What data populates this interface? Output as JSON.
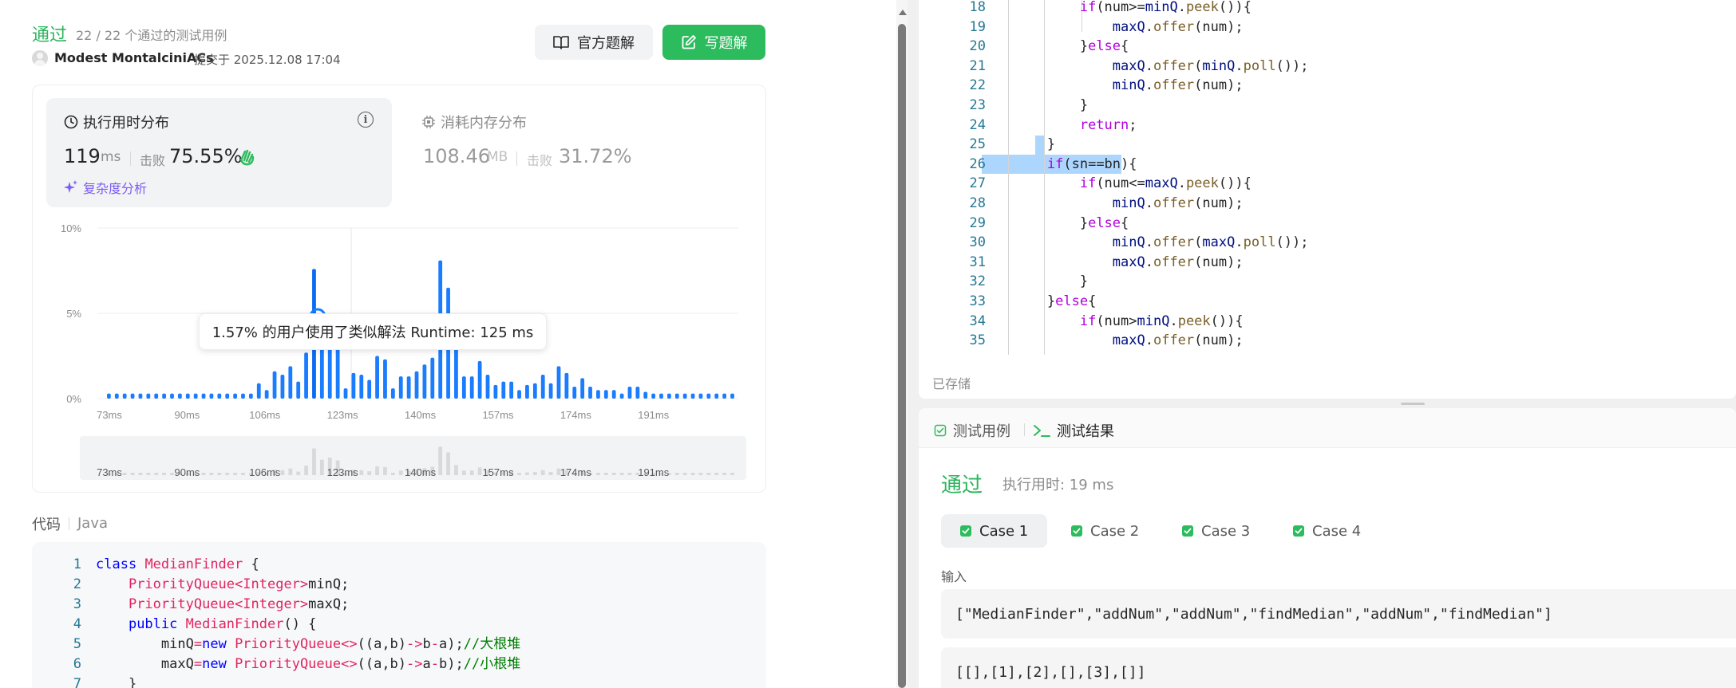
{
  "submission": {
    "status": "通过",
    "passed_cases": "22 / 22 个通过的测试用例",
    "author": "Modest MontalciniACs",
    "submitted_at": "提交于 2025.12.08 17:04",
    "btn_official": "官方题解",
    "btn_write": "写题解"
  },
  "runtime": {
    "title": "执行用时分布",
    "value": "119",
    "unit": "ms",
    "beat_label": "击败",
    "beat_pct": "75.55%",
    "complexity_link": "复杂度分析"
  },
  "memory": {
    "title": "消耗内存分布",
    "value": "108.46",
    "unit": "MB",
    "beat_label": "击败",
    "beat_pct": "31.72%"
  },
  "tooltip": "1.57% 的用户使用了类似解法 Runtime: 125 ms",
  "colors": {
    "accent": "#2cbb5d",
    "bar": "#1a7cff",
    "purple": "#7c5cf5"
  },
  "chart_data": {
    "type": "bar",
    "xlabel": "",
    "ylabel": "",
    "y_ticks": [
      "0%",
      "5%",
      "10%"
    ],
    "x_ticks": [
      "73ms",
      "90ms",
      "106ms",
      "123ms",
      "140ms",
      "157ms",
      "174ms",
      "191ms"
    ],
    "ylim": [
      0,
      10
    ],
    "grid": true,
    "values": [
      0.3,
      0.3,
      0.3,
      0.3,
      0.3,
      0.3,
      0.3,
      0.3,
      0.3,
      0.3,
      0.3,
      0.3,
      0.3,
      0.3,
      0.3,
      0.3,
      0.3,
      0.3,
      0.3,
      0.9,
      0.5,
      1.6,
      1.4,
      1.9,
      1.0,
      2.7,
      7.6,
      4.4,
      5.0,
      4.2,
      0.6,
      1.5,
      1.4,
      1.1,
      2.5,
      2.3,
      0.6,
      1.3,
      1.3,
      1.6,
      2.0,
      2.4,
      8.1,
      6.5,
      2.9,
      1.3,
      1.3,
      2.2,
      1.4,
      0.8,
      1.0,
      1.0,
      0.5,
      0.8,
      0.9,
      1.4,
      0.9,
      1.9,
      1.5,
      0.7,
      1.2,
      0.7,
      0.5,
      0.5,
      0.5,
      0.3,
      0.7,
      0.7,
      0.4,
      0.3,
      0.3,
      0.3,
      0.3,
      0.3,
      0.3,
      0.3,
      0.3,
      0.3,
      0.3,
      0.3
    ],
    "highlight_index": 26
  },
  "code_section": {
    "label": "代码",
    "lang": "Java"
  },
  "left_code": [
    {
      "n": "1",
      "html": "<span class='kw'>class</span> <span class='ty'>MedianFinder</span> <span class='plain'>{</span>"
    },
    {
      "n": "2",
      "html": "    <span class='ty'>PriorityQueue</span><span class='op'>&lt;</span><span class='ty'>Integer</span><span class='op'>&gt;</span><span class='plain'>minQ;</span>"
    },
    {
      "n": "3",
      "html": "    <span class='ty'>PriorityQueue</span><span class='op'>&lt;</span><span class='ty'>Integer</span><span class='op'>&gt;</span><span class='plain'>maxQ;</span>"
    },
    {
      "n": "4",
      "html": "    <span class='kw'>public</span> <span class='ty'>MedianFinder</span><span class='plain'>() {</span>"
    },
    {
      "n": "5",
      "html": "        <span class='plain'>minQ</span><span class='op'>=</span><span class='kw'>new</span> <span class='ty'>PriorityQueue</span><span class='op'>&lt;&gt;</span><span class='plain'>((a,b)</span><span class='op'>-&gt;</span><span class='plain'>b</span><span class='op'>-</span><span class='plain'>a);</span><span class='cm'>//大根堆</span>"
    },
    {
      "n": "6",
      "html": "        <span class='plain'>maxQ</span><span class='op'>=</span><span class='kw'>new</span> <span class='ty'>PriorityQueue</span><span class='op'>&lt;&gt;</span><span class='plain'>((a,b)</span><span class='op'>-&gt;</span><span class='plain'>a</span><span class='op'>-</span><span class='plain'>b);</span><span class='cm'>//小根堆</span>"
    },
    {
      "n": "7",
      "html": "    <span class='plain'>}</span>"
    }
  ],
  "right_code": [
    {
      "n": "18",
      "html": "            <span class='kw2'>if</span><span class='plain'>(num&gt;=</span><span class='var'>minQ</span><span class='plain'>.</span><span class='fn'>peek</span><span class='plain'>()){</span>"
    },
    {
      "n": "19",
      "html": "                <span class='var'>maxQ</span><span class='plain'>.</span><span class='fn'>offer</span><span class='plain'>(num);</span>"
    },
    {
      "n": "20",
      "html": "            <span class='plain'>}</span><span class='kw2'>else</span><span class='plain'>{</span>"
    },
    {
      "n": "21",
      "html": "                <span class='var'>maxQ</span><span class='plain'>.</span><span class='fn'>offer</span><span class='plain'>(</span><span class='var'>minQ</span><span class='plain'>.</span><span class='fn'>poll</span><span class='plain'>());</span>"
    },
    {
      "n": "22",
      "html": "                <span class='var'>minQ</span><span class='plain'>.</span><span class='fn'>offer</span><span class='plain'>(num);</span>"
    },
    {
      "n": "23",
      "html": "            <span class='plain'>}</span>"
    },
    {
      "n": "24",
      "html": "            <span class='kw2'>return</span><span class='plain'>;</span>"
    },
    {
      "n": "25",
      "html": "        <span class='plain'>}</span>"
    },
    {
      "n": "26",
      "html": "        <span class='kw2'>if</span><span class='plain'>(sn==bn){</span>"
    },
    {
      "n": "27",
      "html": "            <span class='kw2'>if</span><span class='plain'>(num&lt;=</span><span class='var'>maxQ</span><span class='plain'>.</span><span class='fn'>peek</span><span class='plain'>()){</span>"
    },
    {
      "n": "28",
      "html": "                <span class='var'>minQ</span><span class='plain'>.</span><span class='fn'>offer</span><span class='plain'>(num);</span>"
    },
    {
      "n": "29",
      "html": "            <span class='plain'>}</span><span class='kw2'>else</span><span class='plain'>{</span>"
    },
    {
      "n": "30",
      "html": "                <span class='var'>minQ</span><span class='plain'>.</span><span class='fn'>offer</span><span class='plain'>(</span><span class='var'>maxQ</span><span class='plain'>.</span><span class='fn'>poll</span><span class='plain'>());</span>"
    },
    {
      "n": "31",
      "html": "                <span class='var'>maxQ</span><span class='plain'>.</span><span class='fn'>offer</span><span class='plain'>(num);</span>"
    },
    {
      "n": "32",
      "html": "            <span class='plain'>}</span>"
    },
    {
      "n": "33",
      "html": "        <span class='plain'>}</span><span class='kw2'>else</span><span class='plain'>{</span>"
    },
    {
      "n": "34",
      "html": "            <span class='kw2'>if</span><span class='plain'>(num&gt;</span><span class='var'>minQ</span><span class='plain'>.</span><span class='fn'>peek</span><span class='plain'>()){</span>"
    },
    {
      "n": "35",
      "html": "                <span class='var'>maxQ</span><span class='plain'>.</span><span class='fn'>offer</span><span class='plain'>(num);</span>"
    }
  ],
  "editor": {
    "saved": "已存储"
  },
  "result": {
    "tab_testcase": "测试用例",
    "tab_result": "测试结果",
    "status": "通过",
    "time": "执行用时: 19 ms",
    "cases": [
      "Case 1",
      "Case 2",
      "Case 3",
      "Case 4"
    ],
    "input_label": "输入",
    "input_line1": "[\"MedianFinder\",\"addNum\",\"addNum\",\"findMedian\",\"addNum\",\"findMedian\"]",
    "input_line2": "[[],[1],[2],[],[3],[]]"
  }
}
